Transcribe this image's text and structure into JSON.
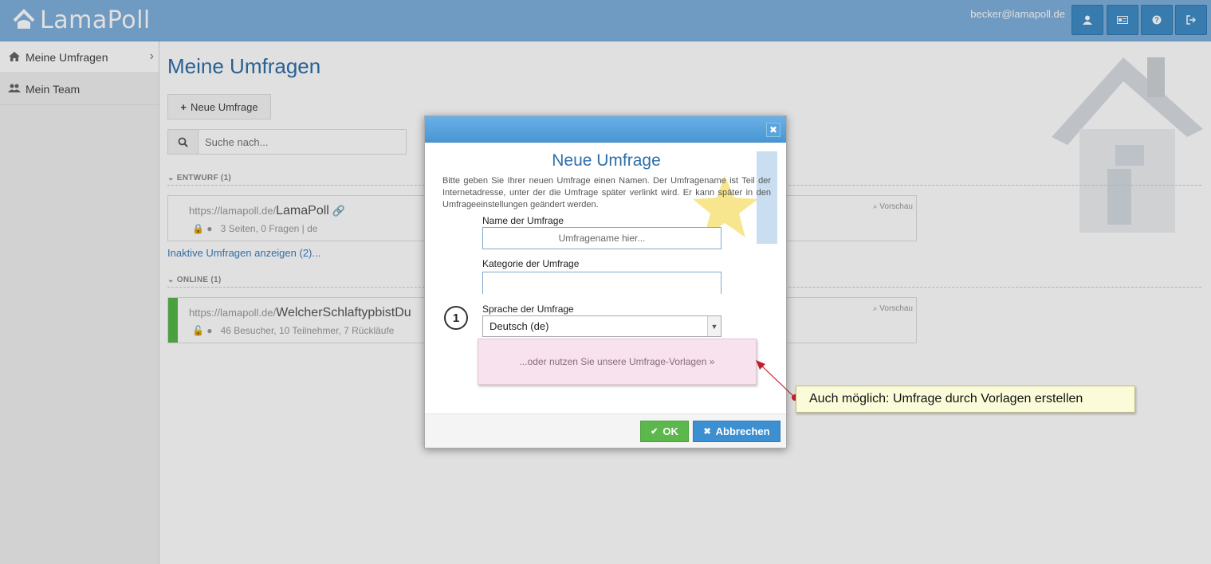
{
  "app": {
    "logo_text": "LamaPoll",
    "user_email": "becker@lamapoll.de"
  },
  "topbar": {
    "buttons": [
      {
        "icon": "user-icon"
      },
      {
        "icon": "id-card-icon"
      },
      {
        "icon": "help-icon"
      },
      {
        "icon": "logout-icon"
      }
    ]
  },
  "sidebar": {
    "items": [
      {
        "label": "Meine Umfragen",
        "icon": "home-icon",
        "active": true
      },
      {
        "label": "Mein Team",
        "icon": "team-icon",
        "active": false
      }
    ]
  },
  "main": {
    "title": "Meine Umfragen",
    "new_button": "Neue Umfrage",
    "search_placeholder": "Suche nach...",
    "sections": [
      {
        "title": "ENTWURF (1)"
      },
      {
        "title": "ONLINE (1)"
      }
    ],
    "cards": [
      {
        "url_prefix": "https://lamapoll.de/",
        "name": "LamaPoll",
        "meta": "3 Seiten, 0 Fragen | de",
        "preview": "Vorschau"
      },
      {
        "url_prefix": "https://lamapoll.de/",
        "name": "WelcherSchlaftypbistDu",
        "meta": "46 Besucher, 10 Teilnehmer, 7 Rückläufe",
        "preview": "Vorschau"
      }
    ],
    "inactive_link": "Inaktive Umfragen anzeigen (2)..."
  },
  "dialog": {
    "title": "Neue Umfrage",
    "description": "Bitte geben Sie Ihrer neuen Umfrage einen Namen. Der Umfragename ist Teil der Internetadresse, unter der die Umfrage später verlinkt wird. Er kann später in den Umfrageeinstellungen geändert werden.",
    "name_label": "Name der Umfrage",
    "name_placeholder": "Umfragename hier...",
    "category_label": "Kategorie der Umfrage",
    "language_label": "Sprache der Umfrage",
    "language_value": "Deutsch (de)",
    "template_link": "...oder nutzen Sie unsere Umfrage-Vorlagen »",
    "step_number": "1",
    "ok_label": "OK",
    "cancel_label": "Abbrechen"
  },
  "callout": {
    "text": "Auch möglich: Umfrage durch Vorlagen erstellen"
  },
  "colors": {
    "accent": "#2f6fa8",
    "topbar": "#7fb0dc",
    "ok": "#5cb84c",
    "cancel": "#3c8fd0",
    "callout_bg": "#fbfbd9",
    "template_bg": "#f7e2ee"
  }
}
